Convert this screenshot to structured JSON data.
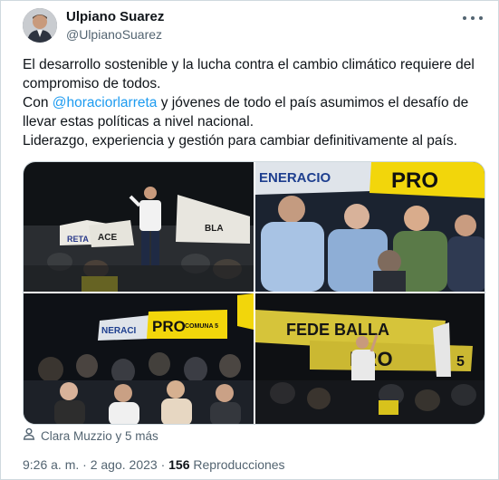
{
  "author": {
    "name": "Ulpiano Suarez",
    "handle": "@UlpianoSuarez"
  },
  "tweet": {
    "line1": "El desarrollo sostenible y la lucha contra el cambio climático requiere del compromiso de todos.",
    "line2_prefix": "Con ",
    "line2_mention": "@horaciorlarreta",
    "line2_suffix": " y jóvenes de todo el país asumimos el desafío de llevar estas políticas a nivel nacional.",
    "line3": "Liderazgo, experiencia y gestión para cambiar definitivamente al país."
  },
  "photos": [
    {
      "banner_1": "RETA",
      "banner_2": "ACE",
      "banner_3": "BLA"
    },
    {
      "banner_1": "ENERACIO",
      "banner_2": "PRO"
    },
    {
      "banner_1": "NERACI",
      "banner_2": "PRO",
      "banner_3": "COMUNA 5"
    },
    {
      "banner_1": "FEDE BALLA",
      "banner_2": "PRO",
      "banner_3": "5"
    }
  ],
  "tagged": {
    "label": "Clara Muzzio y 5 más"
  },
  "meta": {
    "time": "9:26 a. m.",
    "separator": " · ",
    "date": "2 ago. 2023",
    "views_count": "156",
    "views_label": " Reproducciones"
  },
  "colors": {
    "link": "#1d9bf0",
    "text": "#0f1419",
    "secondary": "#536471",
    "pro_yellow": "#f2d60b"
  },
  "icons": {
    "more": "more-dots-icon",
    "tagged": "person-icon"
  }
}
